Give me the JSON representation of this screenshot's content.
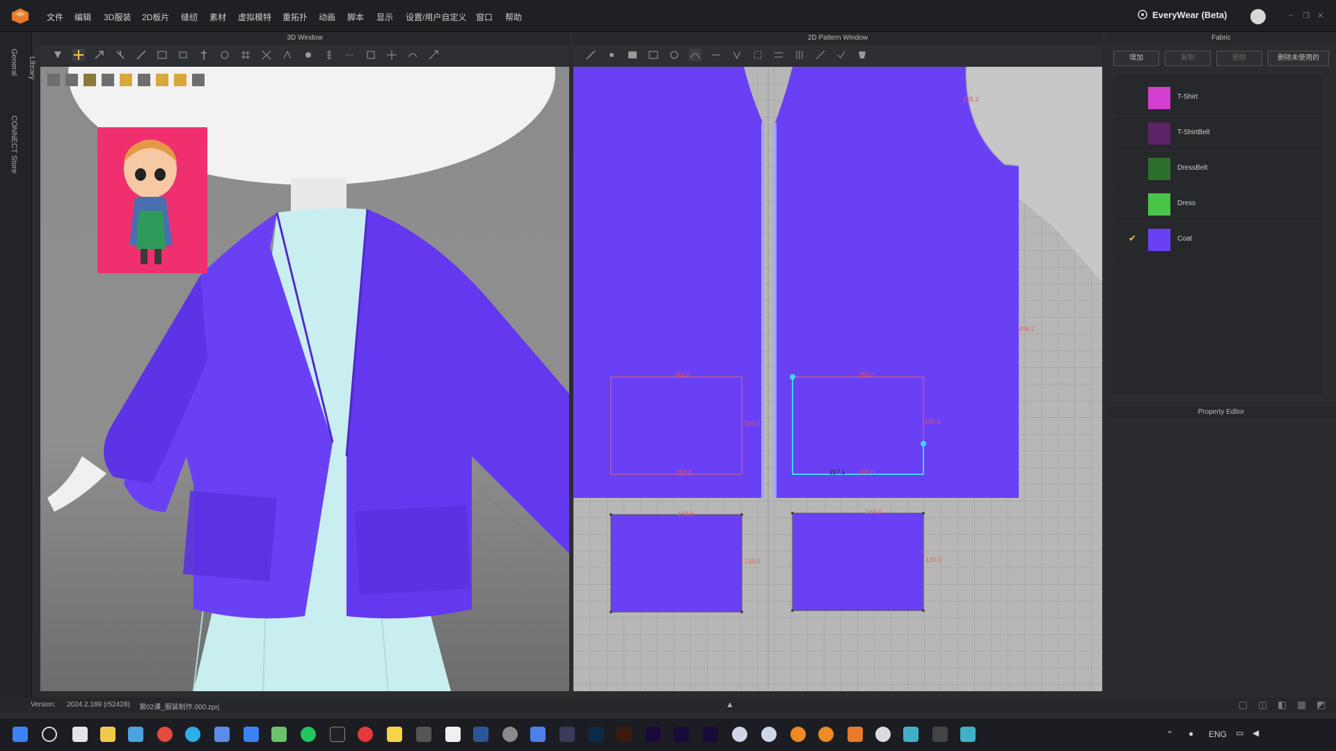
{
  "menubar": {
    "items": [
      "文件",
      "编辑",
      "3D服装",
      "2D板片",
      "缝纫",
      "素材",
      "虚拟模特",
      "重拓扑",
      "动画",
      "脚本",
      "显示",
      "设置/用户自定义",
      "窗口",
      "帮助"
    ],
    "brand": "EveryWear (Beta)"
  },
  "left_strip": {
    "tabs": [
      "General",
      "Library",
      "CONNECT Store"
    ]
  },
  "panels": {
    "view3d_title": "3D Window",
    "view2d_title": "2D Pattern Window",
    "fabric_title": "Fabric",
    "property_title": "Property Editor"
  },
  "fabric": {
    "buttons": [
      "增加",
      "复制",
      "删除",
      "删除未使用的"
    ],
    "items": [
      {
        "name": "T-Shirt",
        "color": "#d43fd0",
        "selected": false
      },
      {
        "name": "T-ShirtBelt",
        "color": "#5c2466",
        "selected": false
      },
      {
        "name": "DressBelt",
        "color": "#2d6f2c",
        "selected": false
      },
      {
        "name": "Dress",
        "color": "#49c449",
        "selected": false
      },
      {
        "name": "Coat",
        "color": "#6a40f5",
        "selected": true
      }
    ],
    "check_glyph": "✔"
  },
  "pattern": {
    "labels": [
      "225.2",
      "408.2",
      "160.0",
      "160.0",
      "120.0",
      "120.0",
      "160.0",
      "160.0",
      "120.0",
      "120.0",
      "217.1",
      "160.0",
      "160.0"
    ]
  },
  "status": {
    "version_label": "Version:",
    "version_value": "2024.2.189 (r52428)",
    "file": "第02课_服装制作.000.zprj"
  },
  "taskbar": {
    "lang": "ENG"
  },
  "colors": {
    "coat": "#6a40f5",
    "dress": "#c8eef0",
    "accent": "#f2c94c"
  }
}
